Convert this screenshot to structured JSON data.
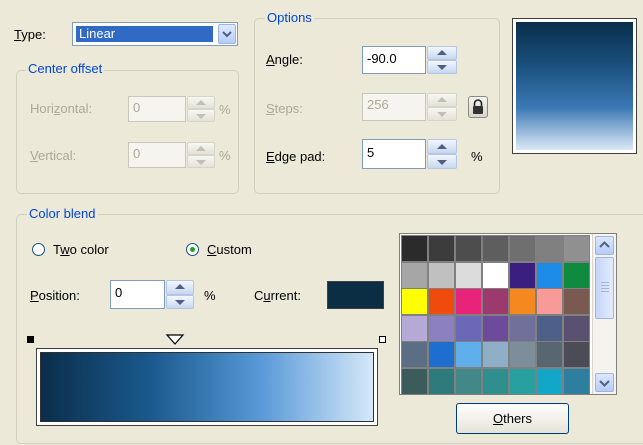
{
  "type_row": {
    "label": "Type:",
    "value": "Linear"
  },
  "center_offset": {
    "title": "Center offset",
    "horizontal_label": "Horizontal:",
    "horizontal_value": "0",
    "vertical_label": "Vertical:",
    "vertical_value": "0",
    "unit": "%"
  },
  "options": {
    "title": "Options",
    "angle_label": "Angle:",
    "angle_value": "-90.0",
    "steps_label": "Steps:",
    "steps_value": "256",
    "edge_pad_label": "Edge pad:",
    "edge_pad_value": "5",
    "unit": "%"
  },
  "preview": {
    "gradient": [
      "#0a2f4c",
      "#1a4f7c",
      "#3b78b4",
      "#dce9f6"
    ]
  },
  "color_blend": {
    "title": "Color blend",
    "two_color_label": "Two color",
    "custom_label": "Custom",
    "selected": "custom",
    "position_label": "Position:",
    "position_value": "0",
    "unit": "%",
    "current_label": "Current:",
    "current_color": "#0b2e45",
    "bar_gradient": [
      "#0b2e4b",
      "#1a5a8e",
      "#5a9ad8",
      "#d5e8f8"
    ]
  },
  "palette": {
    "colors": [
      "#2b2b2b",
      "#3c3c3c",
      "#4d4d4d",
      "#5e5e5e",
      "#6f6f6f",
      "#808080",
      "#909090",
      "#a6a6a6",
      "#c0c0c0",
      "#dcdcdc",
      "#ffffff",
      "#3b1f80",
      "#1d8be8",
      "#0f8b3f",
      "#ffff00",
      "#f04a0c",
      "#e8247a",
      "#9c3a6e",
      "#f5891f",
      "#f89a97",
      "#7a5a50",
      "#b6a9d6",
      "#8d80c0",
      "#6c68b8",
      "#6c4b9a",
      "#70709a",
      "#4e5f88",
      "#5a5070",
      "#5c6e84",
      "#1e6ed0",
      "#5fb0ea",
      "#8faec8",
      "#7d8e9a",
      "#586672",
      "#4c4c56",
      "#3c5c5c",
      "#2f7a7a",
      "#438888",
      "#2f8f8f",
      "#28a0a0",
      "#12a6c8",
      "#2e7ea0"
    ],
    "others_label": "Others"
  }
}
